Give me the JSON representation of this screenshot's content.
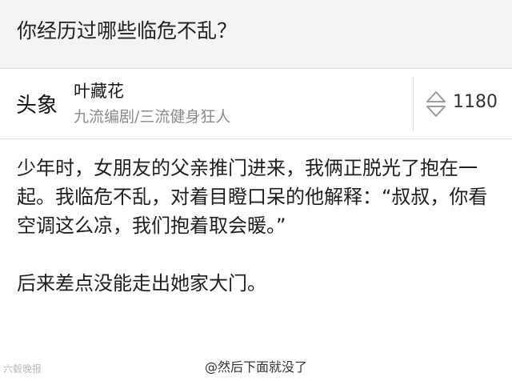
{
  "question": {
    "title": "你经历过哪些临危不乱？"
  },
  "author": {
    "name": "叶藏花",
    "bio": "九流编剧/三流健身狂人",
    "avatar_text": "头象"
  },
  "vote": {
    "count": "1180",
    "icon": "up-down-arrow-icon"
  },
  "answer": {
    "paragraph_1": "少年时，女朋友的父亲推门进来，我俩正脱光了抱在一起。我临危不乱，对着目瞪口呆的他解释：“叔叔，你看空调这么凉，我们抱着取会暖。”",
    "paragraph_2": "后来差点没能走出她家大门。"
  },
  "watermark": {
    "text": "六毂晚报"
  },
  "caption": {
    "text": "@然后下面就没了"
  },
  "colors": {
    "question_bg": "#f4f4f6",
    "text_primary": "#1e1e1e",
    "text_secondary": "#8a8a8e",
    "divider": "#e0e0e4"
  }
}
